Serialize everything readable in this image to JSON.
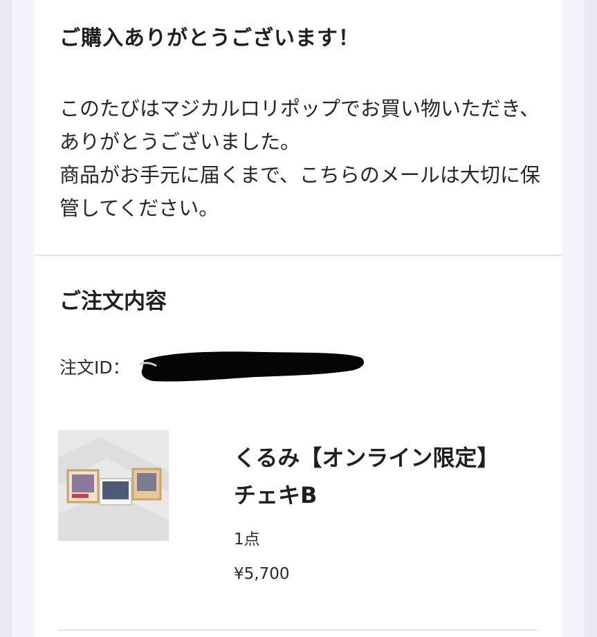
{
  "thanks": {
    "title": "ご購入ありがとうございます！",
    "lines": [
      "このたびはマジカルロリポップでお買い物いただき、ありがとうございました。",
      "商品がお手元に届くまで、こちらのメールは大切に保管してください。"
    ]
  },
  "order": {
    "section_title": "ご注文内容",
    "id_label": "注文ID：",
    "item": {
      "image_icon": "product-photo",
      "name_line1": "くるみ【オンライン限定】",
      "name_line2": "チェキB",
      "quantity": "1点",
      "price": "¥5,700"
    }
  },
  "colors": {
    "page_background": "#e9eaf6",
    "card_background": "#ffffff",
    "divider": "#e3e3ee",
    "text": "#2a2a2a"
  }
}
